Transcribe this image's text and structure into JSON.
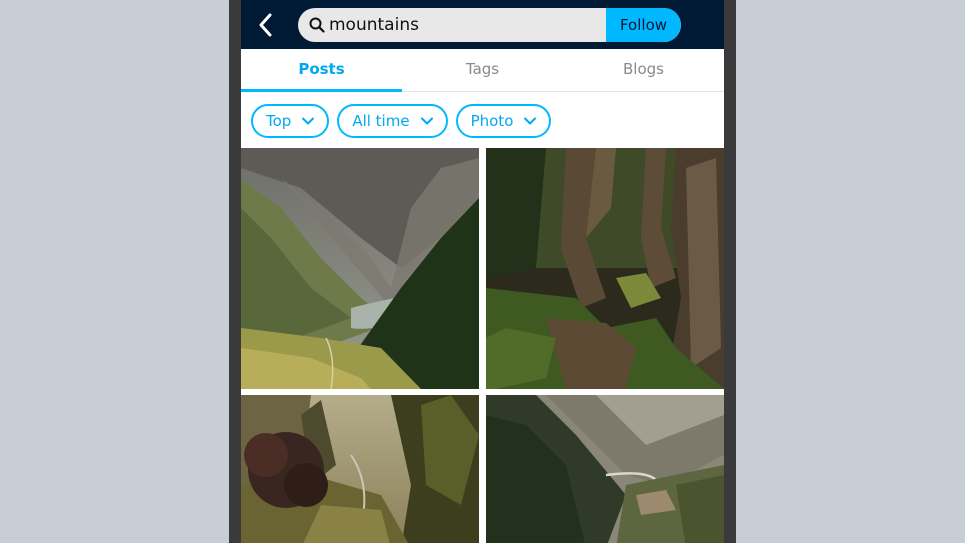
{
  "header": {
    "search_value": "mountains",
    "follow_label": "Follow"
  },
  "tabs": [
    {
      "label": "Posts",
      "active": true
    },
    {
      "label": "Tags",
      "active": false
    },
    {
      "label": "Blogs",
      "active": false
    }
  ],
  "filters": [
    {
      "label": "Top"
    },
    {
      "label": "All time"
    },
    {
      "label": "Photo"
    }
  ],
  "icons": {
    "back": "chevron-left-icon",
    "search": "search-icon",
    "dropdown": "chevron-down-icon"
  },
  "colors": {
    "header_bg": "#001935",
    "accent": "#00b8ff",
    "inactive_tab": "#8a8a8a"
  },
  "posts": [
    {
      "subject": "alpine valley with lake"
    },
    {
      "subject": "mossy forest path"
    },
    {
      "subject": "misty pine valley"
    },
    {
      "subject": "glacial river valley"
    }
  ]
}
